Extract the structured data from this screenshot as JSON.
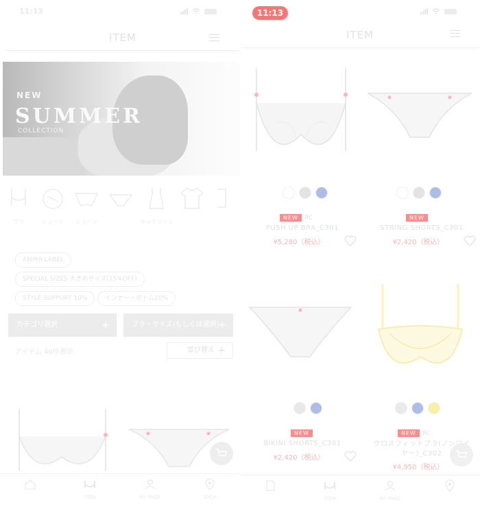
{
  "left": {
    "status": {
      "time": "11:13"
    },
    "header": {
      "title": "ITEM"
    },
    "hero": {
      "subtitle": "NEW",
      "title": "SUMMER",
      "tag": "COLLECTION"
    },
    "categories": [
      {
        "label": "ブラ",
        "icon": "bra-icon"
      },
      {
        "label": "ショーツ",
        "icon": "circle-bra-icon"
      },
      {
        "label": "ショーツ",
        "icon": "shorts-icon"
      },
      {
        "label": "",
        "icon": "briefs-icon"
      },
      {
        "label": "キャミソール",
        "icon": "camisole-icon"
      },
      {
        "label": "",
        "icon": "tshirt-icon"
      },
      {
        "label": "",
        "icon": "more-icon"
      }
    ],
    "filters": {
      "chips": [
        "AMPHI LABEL",
        "SPECIAL SIZES 大きめサイズ(15%OFF)",
        "STYLE SUPPORT 10%",
        "インナー・ボトム10%"
      ],
      "category_select": "カテゴリ選択",
      "size_select": "ブラ・サイズ(もしくは選択)",
      "count_text": "アイテム 40件表示",
      "sort_label": "並び替え"
    },
    "tabs": [
      {
        "label": "",
        "icon": "home-icon"
      },
      {
        "label": "ITEM",
        "icon": "bra-icon"
      },
      {
        "label": "MY PAGE",
        "icon": "user-icon"
      },
      {
        "label": "SHOP",
        "icon": "pin-icon"
      }
    ]
  },
  "right": {
    "status": {
      "time": "11:13"
    },
    "header": {
      "title": "ITEM"
    },
    "products": [
      {
        "badge": "NEW",
        "badge2": "RC",
        "name": "PUSH UP BRA_C301",
        "price": "¥5,280（税込）",
        "swatches": [
          "#ffffff",
          "#e3e3e3",
          "#aebde7"
        ]
      },
      {
        "badge": "NEW",
        "badge2": "",
        "name": "STRING SHORTS_C301",
        "price": "¥2,420（税込）",
        "swatches": [
          "#ffffff",
          "#e3e3e3",
          "#aebde7"
        ]
      },
      {
        "badge": "NEW",
        "badge2": "",
        "name": "BIKINI SHORTS_C301",
        "price": "¥2,420（税込）",
        "swatches": [
          "#e8e8e8",
          "#aebde7"
        ]
      },
      {
        "badge": "NEW",
        "badge2": "RC",
        "name": "クロスフィットブラ(ノンワイヤー)_C302",
        "price": "¥4,950（税込）",
        "swatches": [
          "#eaeaea",
          "#aebde7",
          "#f7f0a6"
        ]
      }
    ],
    "tabs": [
      {
        "label": "",
        "icon": "home-icon"
      },
      {
        "label": "ITEM",
        "icon": "bra-icon"
      },
      {
        "label": "MY PAGE",
        "icon": "user-icon"
      },
      {
        "label": "",
        "icon": "pin-icon"
      }
    ]
  }
}
